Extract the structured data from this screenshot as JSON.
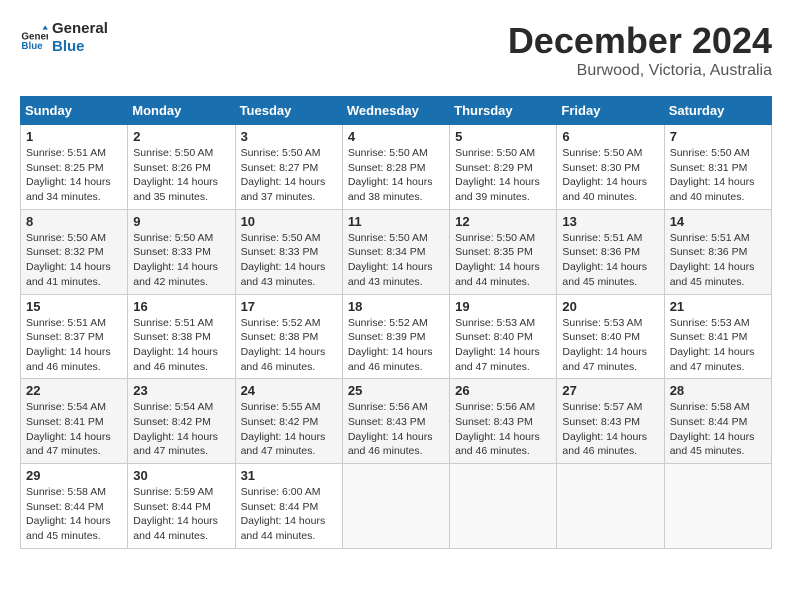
{
  "logo": {
    "line1": "General",
    "line2": "Blue"
  },
  "title": "December 2024",
  "location": "Burwood, Victoria, Australia",
  "headers": [
    "Sunday",
    "Monday",
    "Tuesday",
    "Wednesday",
    "Thursday",
    "Friday",
    "Saturday"
  ],
  "weeks": [
    [
      {
        "day": "1",
        "sunrise": "5:51 AM",
        "sunset": "8:25 PM",
        "daylight": "14 hours and 34 minutes."
      },
      {
        "day": "2",
        "sunrise": "5:50 AM",
        "sunset": "8:26 PM",
        "daylight": "14 hours and 35 minutes."
      },
      {
        "day": "3",
        "sunrise": "5:50 AM",
        "sunset": "8:27 PM",
        "daylight": "14 hours and 37 minutes."
      },
      {
        "day": "4",
        "sunrise": "5:50 AM",
        "sunset": "8:28 PM",
        "daylight": "14 hours and 38 minutes."
      },
      {
        "day": "5",
        "sunrise": "5:50 AM",
        "sunset": "8:29 PM",
        "daylight": "14 hours and 39 minutes."
      },
      {
        "day": "6",
        "sunrise": "5:50 AM",
        "sunset": "8:30 PM",
        "daylight": "14 hours and 40 minutes."
      },
      {
        "day": "7",
        "sunrise": "5:50 AM",
        "sunset": "8:31 PM",
        "daylight": "14 hours and 40 minutes."
      }
    ],
    [
      {
        "day": "8",
        "sunrise": "5:50 AM",
        "sunset": "8:32 PM",
        "daylight": "14 hours and 41 minutes."
      },
      {
        "day": "9",
        "sunrise": "5:50 AM",
        "sunset": "8:33 PM",
        "daylight": "14 hours and 42 minutes."
      },
      {
        "day": "10",
        "sunrise": "5:50 AM",
        "sunset": "8:33 PM",
        "daylight": "14 hours and 43 minutes."
      },
      {
        "day": "11",
        "sunrise": "5:50 AM",
        "sunset": "8:34 PM",
        "daylight": "14 hours and 43 minutes."
      },
      {
        "day": "12",
        "sunrise": "5:50 AM",
        "sunset": "8:35 PM",
        "daylight": "14 hours and 44 minutes."
      },
      {
        "day": "13",
        "sunrise": "5:51 AM",
        "sunset": "8:36 PM",
        "daylight": "14 hours and 45 minutes."
      },
      {
        "day": "14",
        "sunrise": "5:51 AM",
        "sunset": "8:36 PM",
        "daylight": "14 hours and 45 minutes."
      }
    ],
    [
      {
        "day": "15",
        "sunrise": "5:51 AM",
        "sunset": "8:37 PM",
        "daylight": "14 hours and 46 minutes."
      },
      {
        "day": "16",
        "sunrise": "5:51 AM",
        "sunset": "8:38 PM",
        "daylight": "14 hours and 46 minutes."
      },
      {
        "day": "17",
        "sunrise": "5:52 AM",
        "sunset": "8:38 PM",
        "daylight": "14 hours and 46 minutes."
      },
      {
        "day": "18",
        "sunrise": "5:52 AM",
        "sunset": "8:39 PM",
        "daylight": "14 hours and 46 minutes."
      },
      {
        "day": "19",
        "sunrise": "5:53 AM",
        "sunset": "8:40 PM",
        "daylight": "14 hours and 47 minutes."
      },
      {
        "day": "20",
        "sunrise": "5:53 AM",
        "sunset": "8:40 PM",
        "daylight": "14 hours and 47 minutes."
      },
      {
        "day": "21",
        "sunrise": "5:53 AM",
        "sunset": "8:41 PM",
        "daylight": "14 hours and 47 minutes."
      }
    ],
    [
      {
        "day": "22",
        "sunrise": "5:54 AM",
        "sunset": "8:41 PM",
        "daylight": "14 hours and 47 minutes."
      },
      {
        "day": "23",
        "sunrise": "5:54 AM",
        "sunset": "8:42 PM",
        "daylight": "14 hours and 47 minutes."
      },
      {
        "day": "24",
        "sunrise": "5:55 AM",
        "sunset": "8:42 PM",
        "daylight": "14 hours and 47 minutes."
      },
      {
        "day": "25",
        "sunrise": "5:56 AM",
        "sunset": "8:43 PM",
        "daylight": "14 hours and 46 minutes."
      },
      {
        "day": "26",
        "sunrise": "5:56 AM",
        "sunset": "8:43 PM",
        "daylight": "14 hours and 46 minutes."
      },
      {
        "day": "27",
        "sunrise": "5:57 AM",
        "sunset": "8:43 PM",
        "daylight": "14 hours and 46 minutes."
      },
      {
        "day": "28",
        "sunrise": "5:58 AM",
        "sunset": "8:44 PM",
        "daylight": "14 hours and 45 minutes."
      }
    ],
    [
      {
        "day": "29",
        "sunrise": "5:58 AM",
        "sunset": "8:44 PM",
        "daylight": "14 hours and 45 minutes."
      },
      {
        "day": "30",
        "sunrise": "5:59 AM",
        "sunset": "8:44 PM",
        "daylight": "14 hours and 44 minutes."
      },
      {
        "day": "31",
        "sunrise": "6:00 AM",
        "sunset": "8:44 PM",
        "daylight": "14 hours and 44 minutes."
      },
      null,
      null,
      null,
      null
    ]
  ]
}
